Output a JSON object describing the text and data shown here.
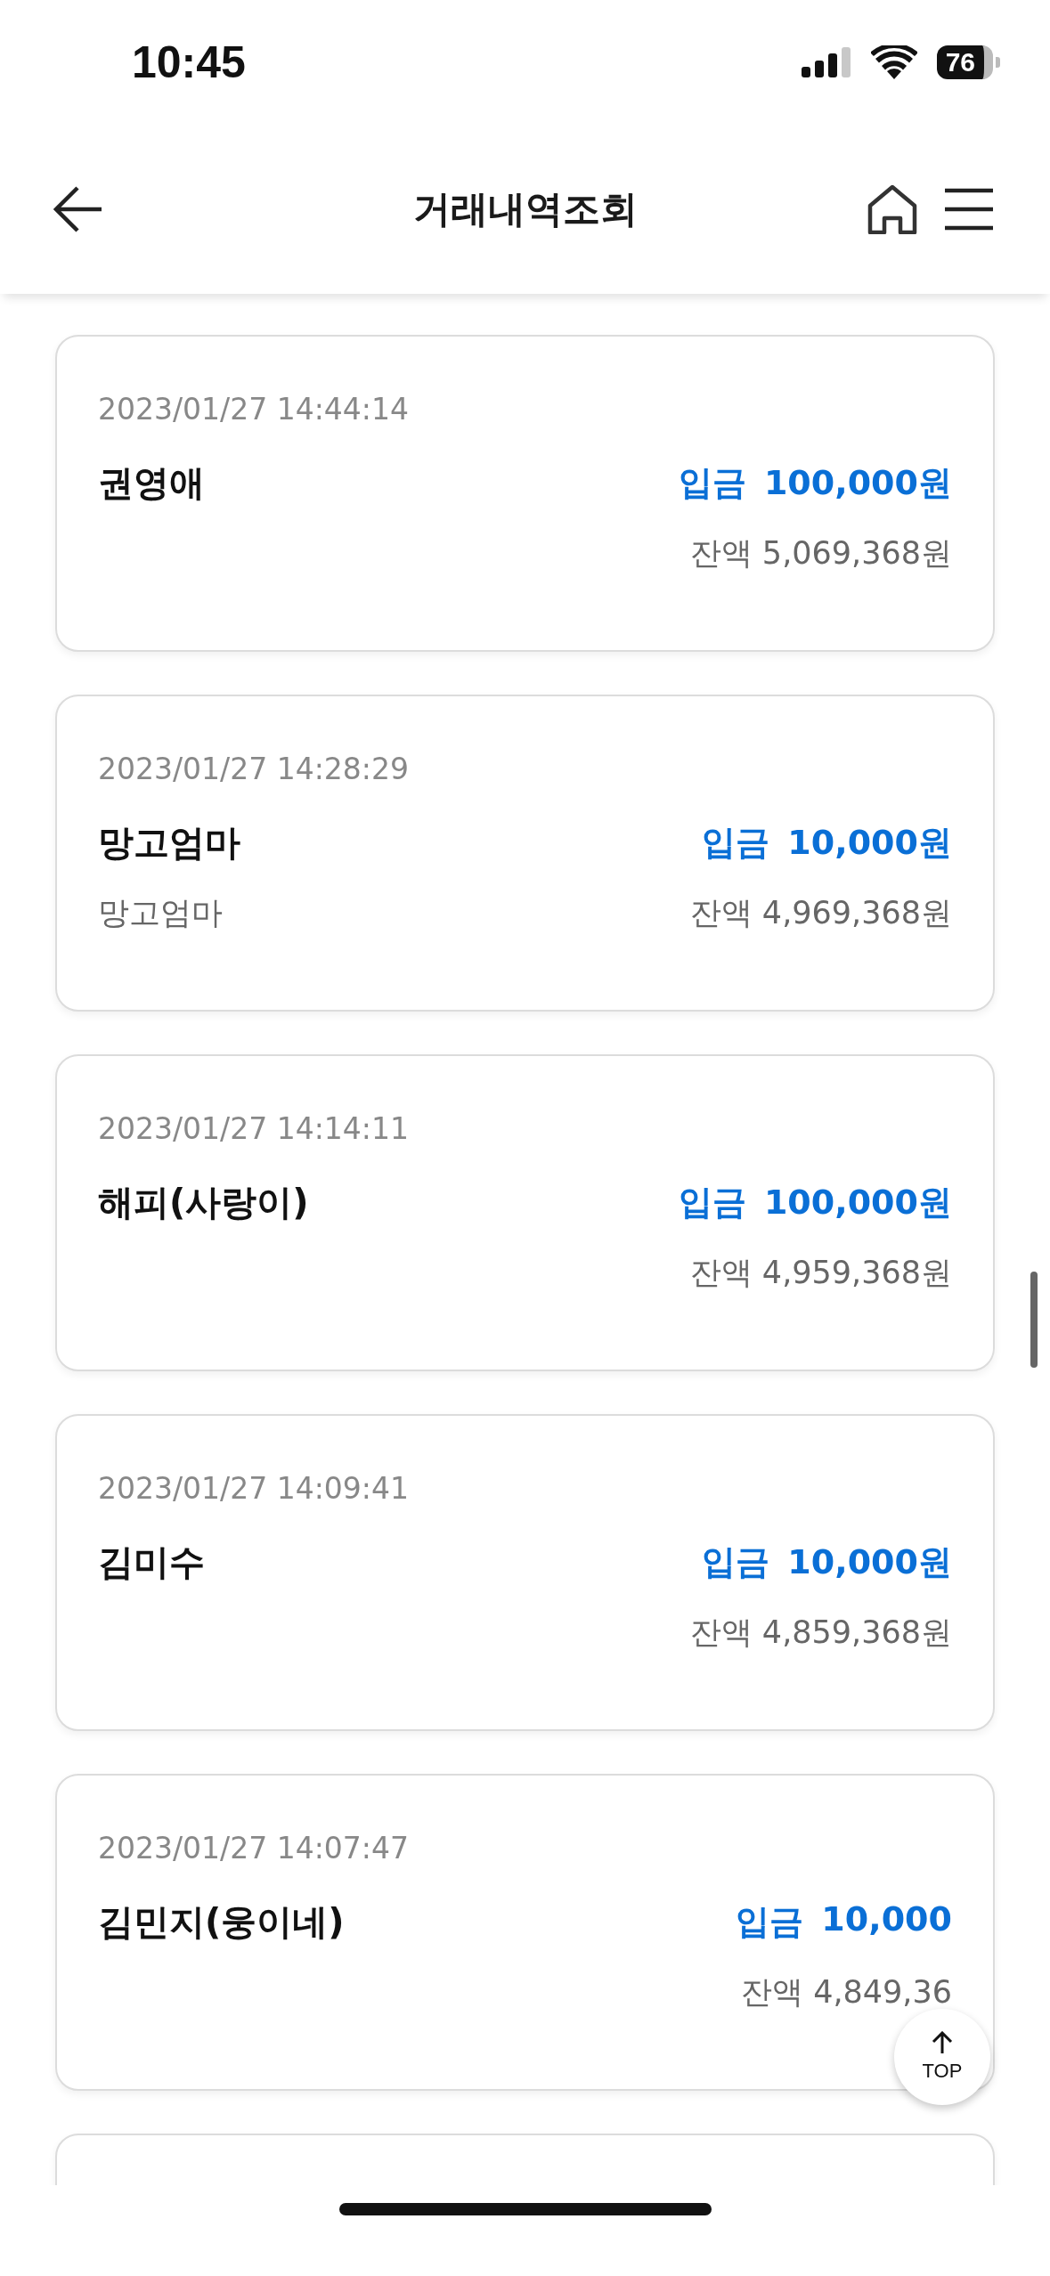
{
  "status_bar": {
    "time": "10:45",
    "battery": "76"
  },
  "header": {
    "title": "거래내역조회"
  },
  "transactions": [
    {
      "datetime": "2023/01/27 14:44:14",
      "name": "권영애",
      "kind": "deposit",
      "type_label": "입금",
      "amount": "100,000원",
      "balance": "잔액 5,069,368원"
    },
    {
      "datetime": "2023/01/27 14:28:29",
      "name": "망고엄마",
      "memo": "망고엄마",
      "kind": "deposit",
      "type_label": "입금",
      "amount": "10,000원",
      "balance": "잔액 4,969,368원"
    },
    {
      "datetime": "2023/01/27 14:14:11",
      "name": "해피(사랑이)",
      "kind": "deposit",
      "type_label": "입금",
      "amount": "100,000원",
      "balance": "잔액 4,959,368원"
    },
    {
      "datetime": "2023/01/27 14:09:41",
      "name": "김미수",
      "kind": "deposit",
      "type_label": "입금",
      "amount": "10,000원",
      "balance": "잔액 4,859,368원"
    },
    {
      "datetime": "2023/01/27 14:07:47",
      "name": "김민지(웅이네)",
      "kind": "deposit",
      "type_label": "입금",
      "amount": "10,000",
      "balance": "잔액 4,849,36"
    }
  ],
  "more_below": true,
  "top_button": {
    "label": "TOP"
  }
}
